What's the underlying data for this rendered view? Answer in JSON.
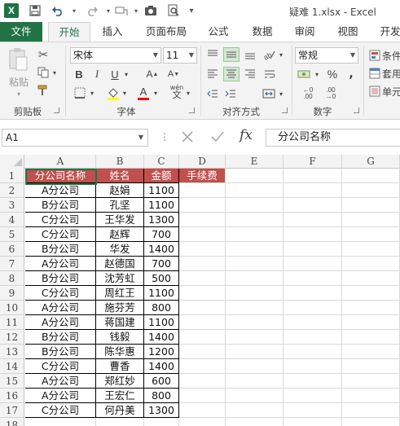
{
  "window": {
    "title": "疑难 1.xlsx - Excel",
    "app_icon": "X"
  },
  "tabs": [
    "文件",
    "开始",
    "插入",
    "页面布局",
    "公式",
    "数据",
    "审阅",
    "视图",
    "开发"
  ],
  "ribbon": {
    "clipboard": {
      "paste_label": "粘贴",
      "group_label": "剪贴板"
    },
    "font": {
      "font_name": "宋体",
      "font_size": "11",
      "group_label": "字体",
      "wen_label": "wén"
    },
    "alignment": {
      "group_label": "对齐方式"
    },
    "number": {
      "format": "常规",
      "group_label": "数字"
    },
    "styles": {
      "item1": "条件",
      "item2": "套用",
      "item3": "单元"
    }
  },
  "formula_bar": {
    "name_box": "A1",
    "fx": "fx",
    "formula": "分公司名称"
  },
  "columns": [
    "A",
    "B",
    "C",
    "D",
    "E",
    "F",
    "G"
  ],
  "rows": [
    "1",
    "2",
    "3",
    "4",
    "5",
    "6",
    "7",
    "8",
    "9",
    "10",
    "11",
    "12",
    "13",
    "14",
    "15",
    "16",
    "17",
    "18"
  ],
  "sheet": {
    "headers": [
      "分公司名称",
      "姓名",
      "金额",
      "手续费"
    ],
    "data": [
      [
        "A分公司",
        "赵娟",
        "1100"
      ],
      [
        "B分公司",
        "孔坚",
        "1100"
      ],
      [
        "C分公司",
        "王华发",
        "1300"
      ],
      [
        "C分公司",
        "赵辉",
        "700"
      ],
      [
        "B分公司",
        "华发",
        "1400"
      ],
      [
        "A分公司",
        "赵德国",
        "700"
      ],
      [
        "B分公司",
        "沈芳虹",
        "500"
      ],
      [
        "C分公司",
        "周红王",
        "1100"
      ],
      [
        "A分公司",
        "施芬芳",
        "800"
      ],
      [
        "A分公司",
        "蒋国建",
        "1100"
      ],
      [
        "B分公司",
        "钱毅",
        "1400"
      ],
      [
        "B分公司",
        "陈华惠",
        "1200"
      ],
      [
        "C分公司",
        "曹香",
        "1400"
      ],
      [
        "A分公司",
        "郑红妙",
        "600"
      ],
      [
        "A分公司",
        "王宏仁",
        "800"
      ],
      [
        "C分公司",
        "何丹美",
        "1300"
      ]
    ]
  },
  "colors": {
    "accent": "#217346",
    "header_fill": "#c0504d"
  }
}
